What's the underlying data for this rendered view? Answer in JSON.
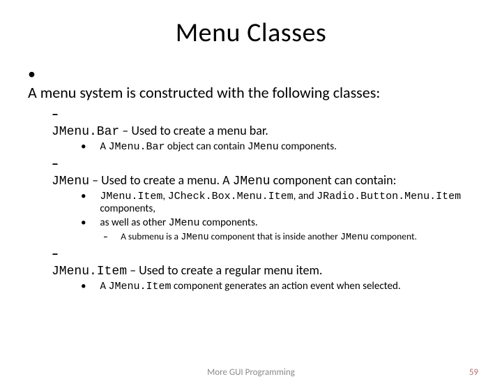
{
  "title": "Menu Classes",
  "b1": "A menu system is constructed with the following classes:",
  "i1_code": "JMenu.Bar",
  "i1_rest": " – Used to create a menu bar.",
  "i1s1_a": "A ",
  "i1s1_code": "JMenu.Bar",
  "i1s1_b": " object can contain ",
  "i1s1_code2": "JMenu",
  "i1s1_c": " components.",
  "i2_code": "JMenu",
  "i2_rest_a": " – Used to create a menu. A ",
  "i2_rest_code": "JMenu",
  "i2_rest_b": " component can contain:",
  "i2s1_c1": "JMenu.Item",
  "i2s1_sep1": ", ",
  "i2s1_c2": "JCheck.Box.Menu.Item",
  "i2s1_sep2": ", and ",
  "i2s1_c3": "JRadio.Button.Menu.Item",
  "i2s1_end": " components,",
  "i2s2_a": "as well as other ",
  "i2s2_code": "JMenu",
  "i2s2_b": " components.",
  "i2s2n_a": "A submenu is a ",
  "i2s2n_code1": "JMenu",
  "i2s2n_b": " component that is inside another ",
  "i2s2n_code2": "JMenu",
  "i2s2n_c": " component.",
  "i3_code": "JMenu.Item",
  "i3_rest": " – Used to create a regular menu item.",
  "i3s1_a": "A ",
  "i3s1_code": "JMenu.Item",
  "i3s1_b": " component generates an action event when selected.",
  "footer_center": "More GUI Programming",
  "footer_page": "59"
}
